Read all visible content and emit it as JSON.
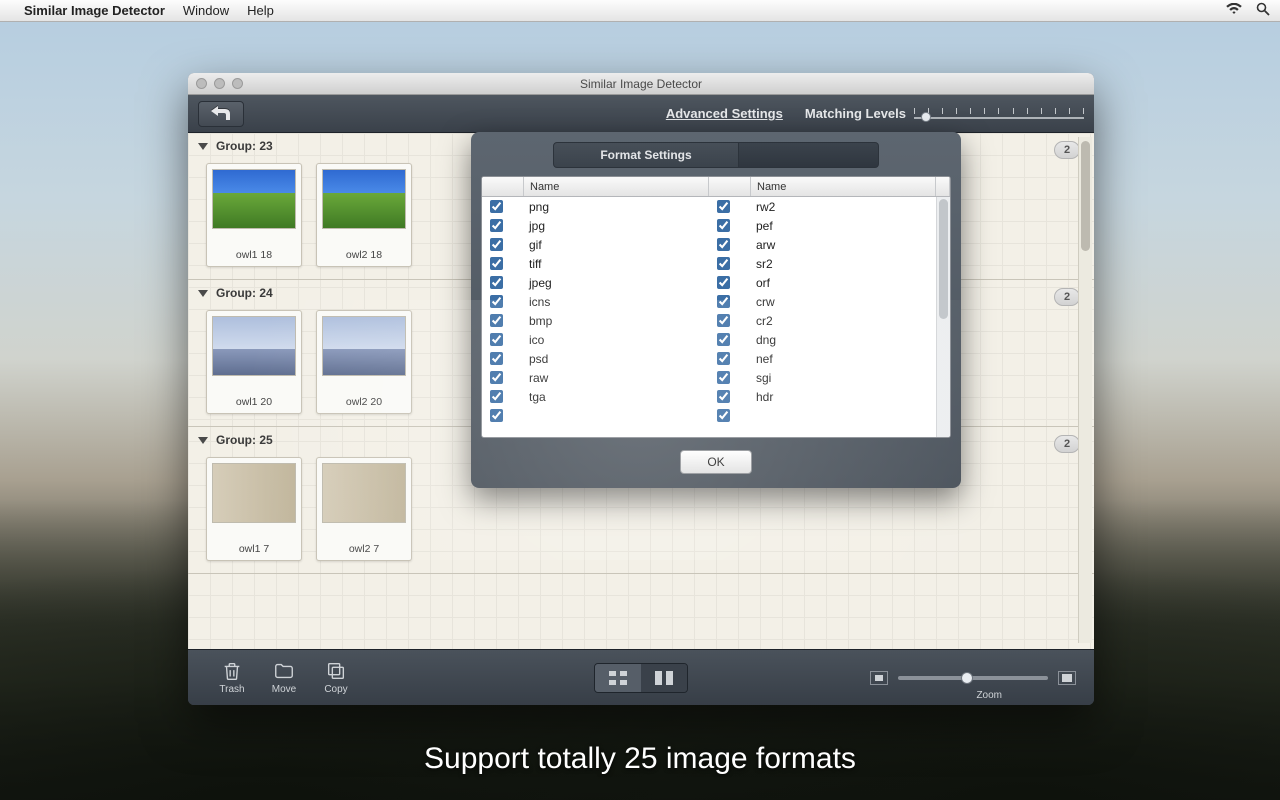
{
  "menubar": {
    "app_name": "Similar Image Detector",
    "items": [
      "Window",
      "Help"
    ]
  },
  "window": {
    "title": "Similar Image Detector"
  },
  "toolbar": {
    "advanced_settings": "Advanced Settings",
    "matching_levels": "Matching Levels",
    "matching_tick_count": 13,
    "matching_thumb_pct": 4
  },
  "groups": [
    {
      "name": "Group: 23",
      "count": "2",
      "thumbs": [
        {
          "label": "owl1 18",
          "art": "field"
        },
        {
          "label": "owl2 18",
          "art": "field"
        }
      ]
    },
    {
      "name": "Group: 24",
      "count": "2",
      "thumbs": [
        {
          "label": "owl1 20",
          "art": "snow"
        },
        {
          "label": "owl2 20",
          "art": "snow"
        }
      ]
    },
    {
      "name": "Group: 25",
      "count": "2",
      "thumbs": [
        {
          "label": "owl1 7",
          "art": "porch"
        },
        {
          "label": "owl2 7",
          "art": "porch"
        }
      ]
    }
  ],
  "bottombar": {
    "trash": "Trash",
    "move": "Move",
    "copy": "Copy",
    "zoom": "Zoom",
    "zoom_thumb_pct": 46
  },
  "popover": {
    "tab": "Format Settings",
    "col_header": "Name",
    "ok": "OK",
    "left": [
      "png",
      "jpg",
      "gif",
      "tiff",
      "jpeg",
      "icns",
      "bmp",
      "ico",
      "psd",
      "raw",
      "tga"
    ],
    "right": [
      "rw2",
      "pef",
      "arw",
      "sr2",
      "orf",
      "crw",
      "cr2",
      "dng",
      "nef",
      "sgi",
      "hdr"
    ]
  },
  "caption": "Support totally 25 image formats"
}
